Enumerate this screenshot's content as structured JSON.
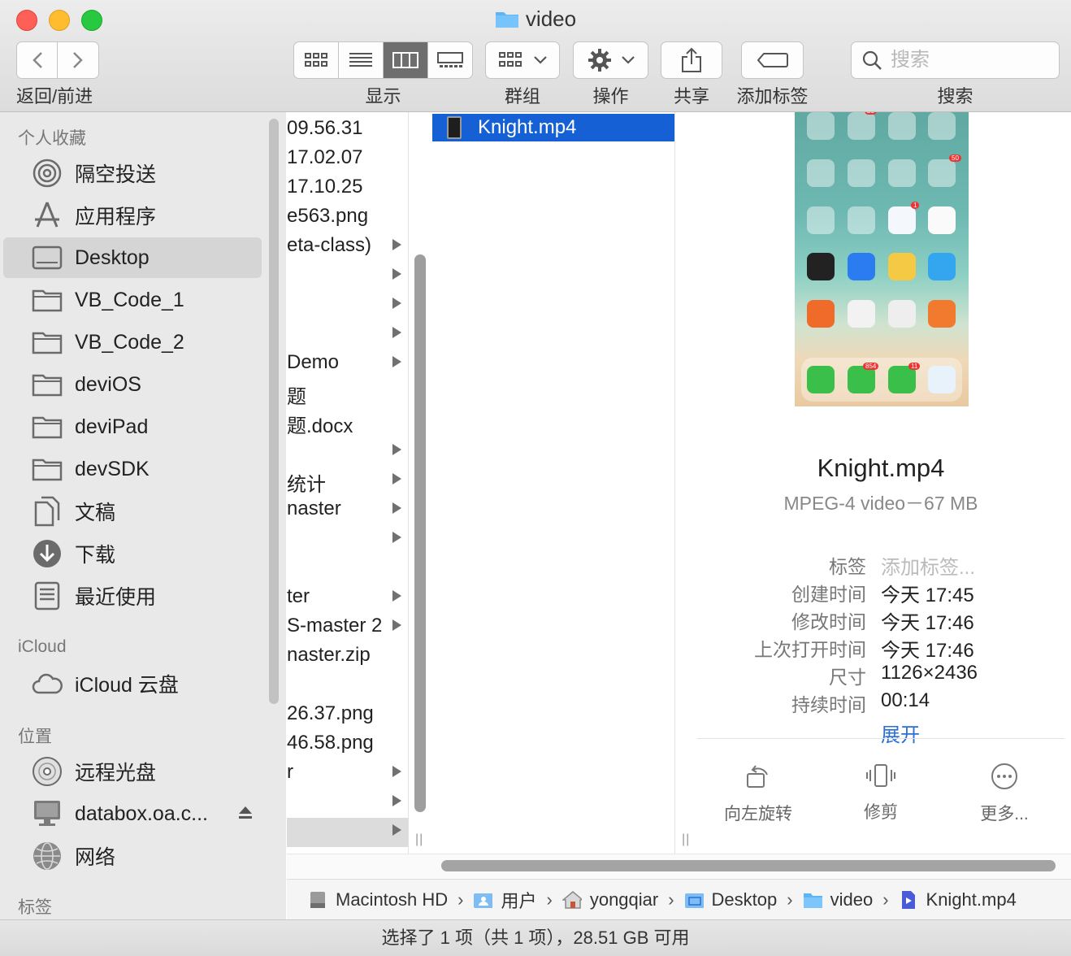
{
  "window": {
    "title": "video"
  },
  "toolbar": {
    "nav_label": "返回/前进",
    "view_label": "显示",
    "group_label": "群组",
    "action_label": "操作",
    "share_label": "共享",
    "tag_label": "添加标签",
    "search_label": "搜索",
    "search_placeholder": "搜索"
  },
  "sidebar": {
    "favorites_header": "个人收藏",
    "favorites": [
      {
        "label": "隔空投送",
        "icon": "airdrop-icon"
      },
      {
        "label": "应用程序",
        "icon": "applications-icon"
      },
      {
        "label": "Desktop",
        "icon": "desktop-icon",
        "selected": true
      },
      {
        "label": "VB_Code_1",
        "icon": "folder-icon"
      },
      {
        "label": "VB_Code_2",
        "icon": "folder-icon"
      },
      {
        "label": "deviOS",
        "icon": "folder-icon"
      },
      {
        "label": "deviPad",
        "icon": "folder-icon"
      },
      {
        "label": "devSDK",
        "icon": "folder-icon"
      },
      {
        "label": "文稿",
        "icon": "documents-icon"
      },
      {
        "label": "下载",
        "icon": "downloads-icon"
      },
      {
        "label": "最近使用",
        "icon": "recents-icon"
      }
    ],
    "icloud_header": "iCloud",
    "icloud": [
      {
        "label": "iCloud 云盘",
        "icon": "cloud-icon"
      }
    ],
    "locations_header": "位置",
    "locations": [
      {
        "label": "远程光盘",
        "icon": "disc-icon"
      },
      {
        "label": "databox.oa.c...",
        "icon": "computer-icon"
      },
      {
        "label": "网络",
        "icon": "network-icon"
      }
    ],
    "tags_header": "标签"
  },
  "column1": [
    {
      "name": "09.56.31",
      "arrow": false
    },
    {
      "name": "17.02.07",
      "arrow": false
    },
    {
      "name": "17.10.25",
      "arrow": false
    },
    {
      "name": "e563.png",
      "arrow": false
    },
    {
      "name": "eta-class)",
      "arrow": true
    },
    {
      "name": "",
      "arrow": true
    },
    {
      "name": "",
      "arrow": true
    },
    {
      "name": "",
      "arrow": true
    },
    {
      "name": "Demo",
      "arrow": true
    },
    {
      "name": "题",
      "arrow": false
    },
    {
      "name": "题.docx",
      "arrow": false
    },
    {
      "name": "",
      "arrow": true
    },
    {
      "name": "统计",
      "arrow": true
    },
    {
      "name": "naster",
      "arrow": true
    },
    {
      "name": "",
      "arrow": true
    },
    {
      "name": "",
      "arrow": false
    },
    {
      "name": "ter",
      "arrow": true
    },
    {
      "name": "S-master 2",
      "arrow": true
    },
    {
      "name": "naster.zip",
      "arrow": false
    },
    {
      "name": "",
      "arrow": false
    },
    {
      "name": "26.37.png",
      "arrow": false
    },
    {
      "name": "46.58.png",
      "arrow": false
    },
    {
      "name": "r",
      "arrow": true
    },
    {
      "name": "",
      "arrow": true
    },
    {
      "name": "",
      "arrow": true,
      "selected": true
    }
  ],
  "column2": {
    "selected_file": "Knight.mp4"
  },
  "preview": {
    "filename": "Knight.mp4",
    "kind": "MPEG-4 video－67 MB",
    "badges": {
      "a": "23",
      "b": "50",
      "c": "1",
      "phone": "854",
      "wechat": "11"
    },
    "meta": {
      "tags_label": "标签",
      "tags_value": "添加标签...",
      "created_label": "创建时间",
      "created_value": "今天 17:45",
      "modified_label": "修改时间",
      "modified_value": "今天 17:46",
      "opened_label": "上次打开时间",
      "opened_value": "今天 17:46",
      "dimensions_label": "尺寸",
      "dimensions_value": "1126×2436",
      "duration_label": "持续时间",
      "duration_value": "00:14",
      "expand_label": "展开"
    },
    "actions": {
      "rotate": "向左旋转",
      "trim": "修剪",
      "more": "更多..."
    }
  },
  "path": [
    "Macintosh HD",
    "用户",
    "yongqiar",
    "Desktop",
    "video",
    "Knight.mp4"
  ],
  "status": "选择了 1 项（共 1 项），28.51 GB 可用"
}
